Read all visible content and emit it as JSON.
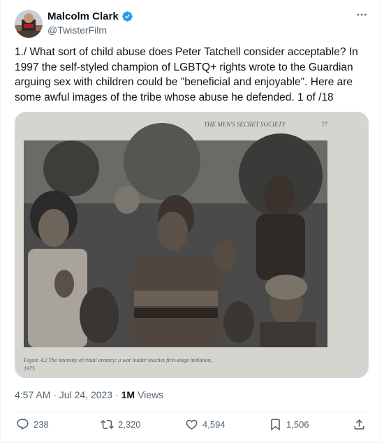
{
  "author": {
    "display_name": "Malcolm Clark",
    "handle": "@TwisterFilm",
    "verified_icon": "verified-badge-icon",
    "verified_color": "#1d9bf0"
  },
  "tweet": {
    "text": "1./  What sort of child abuse does Peter Tatchell consider acceptable? In 1997 the self-styled champion of LGBTQ+ rights wrote to the Guardian arguing sex with children could be \"beneficial and enjoyable\". Here are some awful images of the tribe whose abuse he defended.  1 of /18"
  },
  "media": {
    "page_header": "THE MEN'S SECRET SOCIETY",
    "page_number": "77",
    "caption_line1": "Figure 4.2  The intensity of ritual oratory: a war leader teaches first-stage initiation,",
    "caption_line2": "1975"
  },
  "meta": {
    "timestamp": "4:57 AM · Jul 24, 2023 · ",
    "views_count": "1M",
    "views_label": "Views"
  },
  "actions": {
    "replies": "238",
    "retweets": "2,320",
    "likes": "4,594",
    "bookmarks": "1,506"
  },
  "colors": {
    "text_primary": "#0f1419",
    "text_secondary": "#536471",
    "border": "#cfd9de",
    "accent": "#1d9bf0"
  }
}
